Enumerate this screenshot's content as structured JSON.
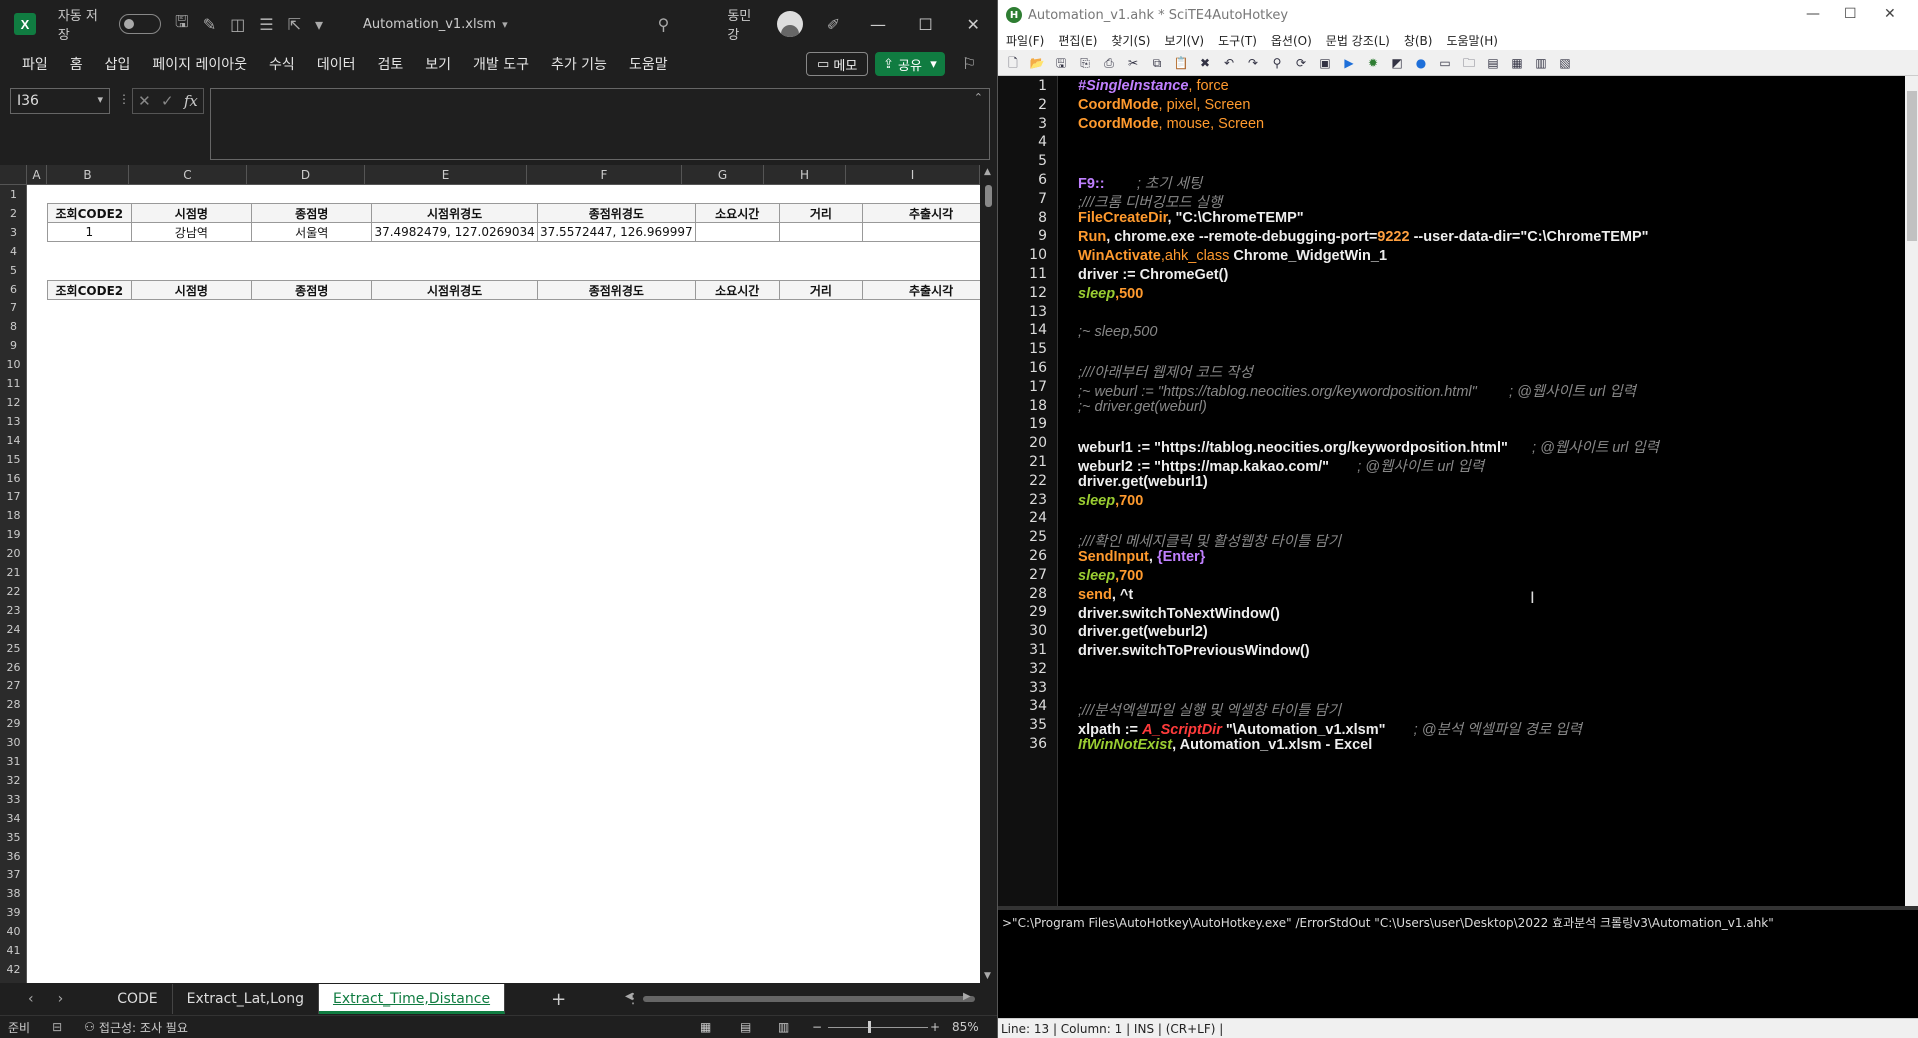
{
  "excel": {
    "autosave_label": "자동 저장",
    "filename": "Automation_v1.xlsm",
    "user": "동민 강",
    "menu": [
      "파일",
      "홈",
      "삽입",
      "페이지 레이아웃",
      "수식",
      "데이터",
      "검토",
      "보기",
      "개발 도구",
      "추가 기능",
      "도움말"
    ],
    "memo_label": "메모",
    "share_label": "공유",
    "namebox": "I36",
    "fx": "fx",
    "columns": [
      "A",
      "B",
      "C",
      "D",
      "E",
      "F",
      "G",
      "H",
      "I"
    ],
    "rows": [
      "1",
      "2",
      "3",
      "4",
      "5",
      "6",
      "7",
      "8",
      "9",
      "10",
      "11",
      "12",
      "13",
      "14",
      "15",
      "16",
      "17",
      "18",
      "19",
      "20",
      "21",
      "22",
      "23",
      "24",
      "25",
      "26",
      "27",
      "28",
      "29",
      "30",
      "31",
      "32",
      "33",
      "34",
      "35",
      "36",
      "37",
      "38",
      "39",
      "40",
      "41",
      "42"
    ],
    "table1_header": [
      "조회CODE2",
      "시점명",
      "종점명",
      "시점위경도",
      "종점위경도",
      "소요시간",
      "거리",
      "추출시각"
    ],
    "table1_row": [
      "1",
      "강남역",
      "서울역",
      "37.4982479, 127.0269034",
      "37.5572447, 126.969997",
      "",
      "",
      ""
    ],
    "table2_header": [
      "조회CODE2",
      "시점명",
      "종점명",
      "시점위경도",
      "종점위경도",
      "소요시간",
      "거리",
      "추출시각"
    ],
    "sheets": [
      "CODE",
      "Extract_Lat,Long",
      "Extract_Time,Distance"
    ],
    "add_sheet": "+",
    "status_ready": "준비",
    "status_accessibility": "접근성: 조사 필요",
    "zoom": "85%",
    "icons": [
      "excel-logo-icon",
      "save-icon",
      "undo-icon",
      "search-icon",
      "minimize-icon",
      "maximize-icon",
      "close-icon"
    ]
  },
  "scite": {
    "title": "Automation_v1.ahk * SciTE4AutoHotkey",
    "menu": [
      "파일(F)",
      "편집(E)",
      "찾기(S)",
      "보기(V)",
      "도구(T)",
      "옵션(O)",
      "문법 강조(L)",
      "창(B)",
      "도움말(H)"
    ],
    "line_numbers": [
      "1",
      "2",
      "3",
      "4",
      "5",
      "6",
      "7",
      "8",
      "9",
      "10",
      "11",
      "12",
      "13",
      "14",
      "15",
      "16",
      "17",
      "18",
      "19",
      "20",
      "21",
      "22",
      "23",
      "24",
      "25",
      "26",
      "27",
      "28",
      "29",
      "30",
      "31",
      "32",
      "33",
      "34",
      "35",
      "36"
    ],
    "output": ">\"C:\\Program Files\\AutoHotkey\\AutoHotkey.exe\" /ErrorStdOut \"C:\\Users\\user\\Desktop\\2022 효과분석 크롤링v3\\Automation_v1.ahk\"",
    "status": "Line: 13 | Column: 1 | INS | (CR+LF) |"
  },
  "code": {
    "l1a": "#SingleInstance",
    "l1b": ", force",
    "l2a": "CoordMode",
    "l2b": ", pixel, Screen",
    "l3a": "CoordMode",
    "l3b": ", mouse, Screen",
    "l6a": "F9::",
    "l6b": "        ; 초기 세팅",
    "l7": ";///크롬 디버깅모드 실행",
    "l8a": "FileCreateDir",
    "l8b": ", \"C:\\ChromeTEMP\"",
    "l9a": "Run",
    "l9b": ", chrome.exe --remote-debugging-port=",
    "l9c": "9222",
    "l9d": " --user-data-dir=\"C:\\ChromeTEMP\"",
    "l10a": "WinActivate",
    "l10b": ",ahk_class",
    "l10c": " Chrome_WidgetWin_1",
    "l11a": "driver := ",
    "l11b": "ChromeGet()",
    "l12a": "sleep",
    "l12b": ",500",
    "l14": ";~ sleep,500",
    "l16": ";///아래부터 웹제어 코드 작성",
    "l17": ";~ weburl := \"https://tablog.neocities.org/keywordposition.html\"        ; @웹사이트 url 입력",
    "l18": ";~ driver.get(weburl)",
    "l20a": "weburl1 := \"https://tablog.neocities.org/keywordposition.html\"",
    "l20b": "      ; @웹사이트 url 입력",
    "l21a": "weburl2 := \"https://map.kakao.com/\"",
    "l21b": "       ; @웹사이트 url 입력",
    "l22": "driver.get(weburl1)",
    "l23a": "sleep",
    "l23b": ",700",
    "l25": ";///확인 메세지클릭 및 활성웹창 타이틀 담기",
    "l26a": "SendInput",
    "l26b": ", ",
    "l26c": "{Enter}",
    "l27a": "sleep",
    "l27b": ",700",
    "l28a": "send",
    "l28b": ", ^t",
    "l29": "driver.switchToNextWindow()",
    "l30": "driver.get(weburl2)",
    "l31": "driver.switchToPreviousWindow()",
    "l34": ";///분석엑셀파일 실행 및 엑셀창 타이틀 담기",
    "l35a": "xlpath := ",
    "l35b": "A_ScriptDir",
    "l35c": " \"\\Automation_v1.xlsm\"",
    "l35d": "       ; @분석 엑셀파일 경로 입력",
    "l36a": "IfWinNotExist",
    "l36b": ", Automation_v1.xlsm - Excel"
  }
}
